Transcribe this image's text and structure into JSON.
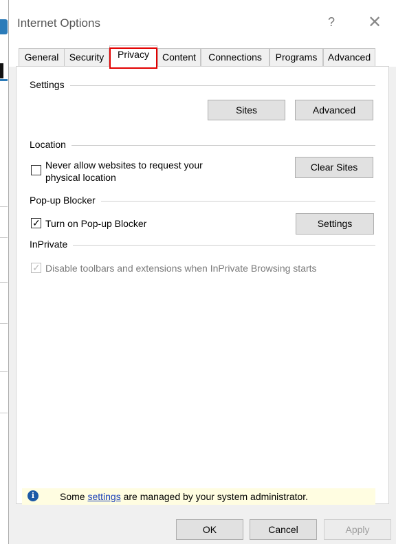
{
  "window": {
    "title": "Internet Options",
    "help_glyph": "?",
    "close_glyph": "✕"
  },
  "tabs": [
    {
      "label": "General"
    },
    {
      "label": "Security"
    },
    {
      "label": "Privacy",
      "selected": true
    },
    {
      "label": "Content"
    },
    {
      "label": "Connections"
    },
    {
      "label": "Programs"
    },
    {
      "label": "Advanced"
    }
  ],
  "settings_group": {
    "label": "Settings",
    "sites_button": "Sites",
    "advanced_button": "Advanced"
  },
  "location_group": {
    "label": "Location",
    "checkbox_label_line1": "Never allow websites to request your",
    "checkbox_label_line2": "physical location",
    "checked": false,
    "clear_sites_button": "Clear Sites"
  },
  "popup_group": {
    "label": "Pop-up Blocker",
    "checkbox_label": "Turn on Pop-up Blocker",
    "checked": true,
    "settings_button": "Settings"
  },
  "inprivate_group": {
    "label": "InPrivate",
    "checkbox_label": "Disable toolbars and extensions when InPrivate Browsing starts",
    "checked": true,
    "enabled": false
  },
  "info_bar": {
    "icon": "info-icon",
    "text_before": "Some ",
    "link_text": "settings",
    "text_after": " are managed by your system administrator."
  },
  "buttons": {
    "ok": "OK",
    "cancel": "Cancel",
    "apply": "Apply"
  },
  "colors": {
    "selected_tab_outline": "#e20000",
    "info_bar_bg": "#fffde1",
    "link": "#1a3fb8"
  }
}
